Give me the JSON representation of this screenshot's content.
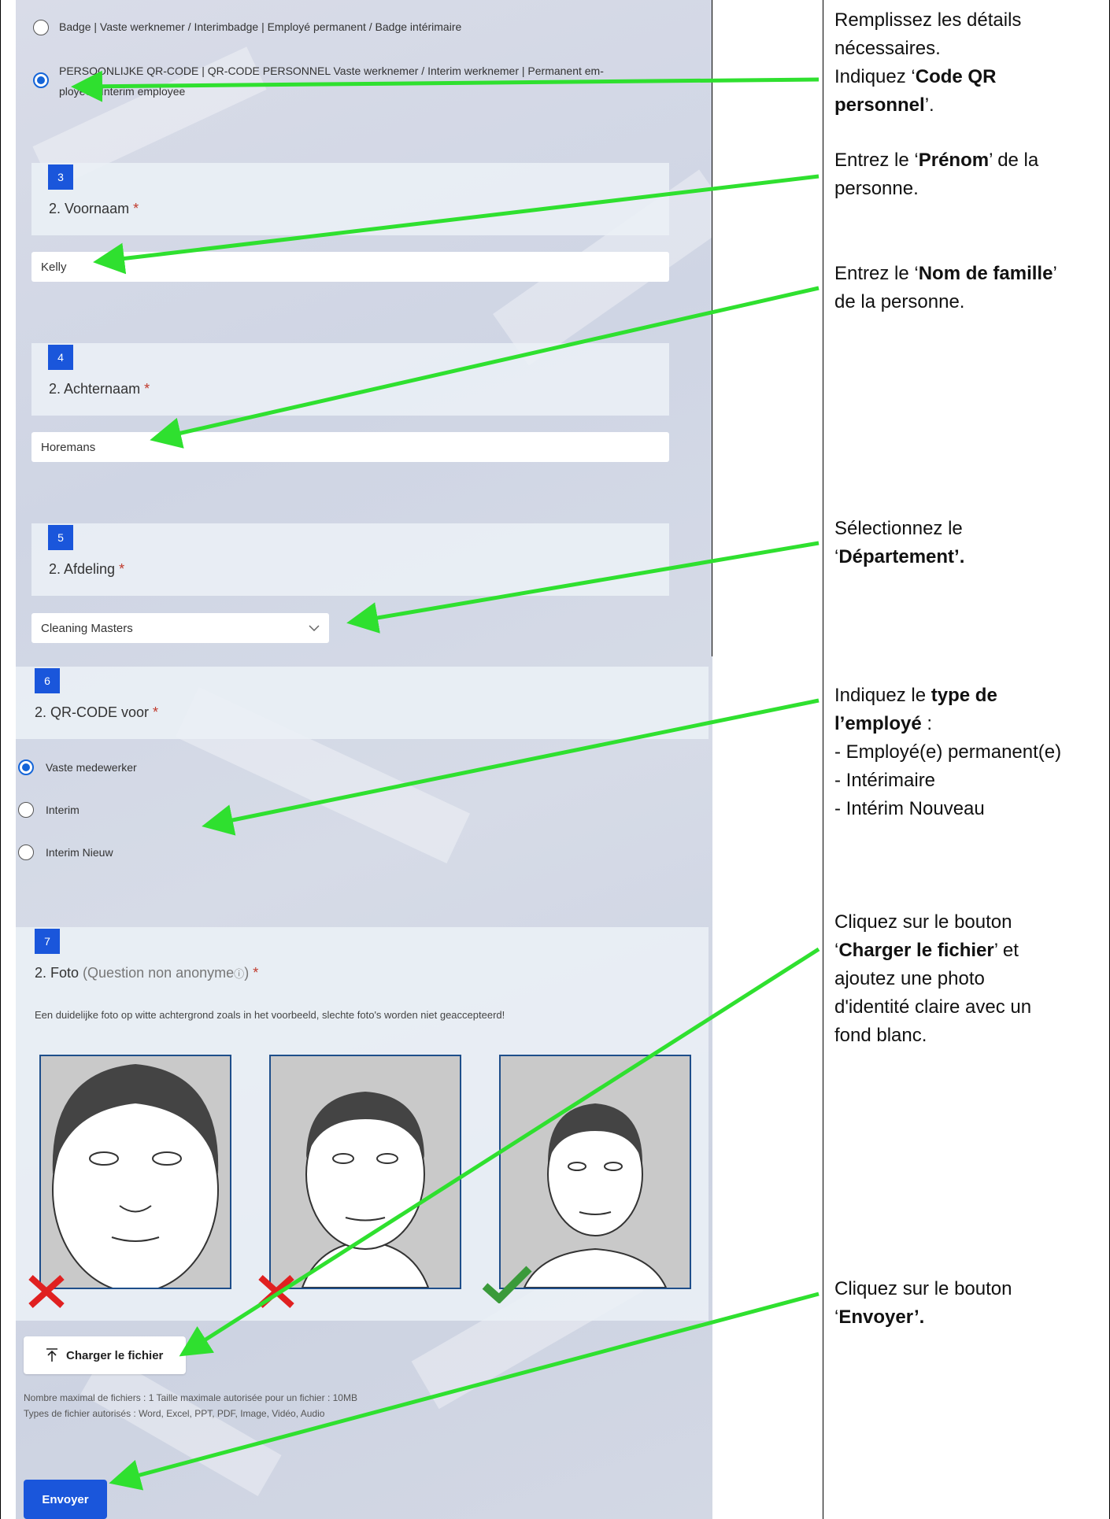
{
  "form": {
    "options_q1": [
      {
        "label": "Badge | Vaste werknemer / Interimbadge | Employé permanent / Badge intérimaire",
        "selected": false
      },
      {
        "label_line1": "PERSOONLIJKE QR-CODE | QR-CODE PERSONNEL  Vaste werknemer / Interim werknemer | Permanent em-",
        "label_line2": "ployee / Interim employee",
        "selected": true
      }
    ],
    "q3": {
      "number": "3",
      "title": "2. Voornaam",
      "required_mark": "*",
      "value": "Kelly"
    },
    "q4": {
      "number": "4",
      "title": "2. Achternaam",
      "required_mark": "*",
      "value": "Horemans"
    },
    "q5": {
      "number": "5",
      "title": "2. Afdeling",
      "required_mark": "*",
      "value": "Cleaning Masters"
    },
    "q6": {
      "number": "6",
      "title": "2. QR-CODE voor",
      "required_mark": "*",
      "options": [
        {
          "label": "Vaste medewerker",
          "selected": true
        },
        {
          "label": "Interim",
          "selected": false
        },
        {
          "label": "Interim Nieuw",
          "selected": false
        }
      ]
    },
    "q7": {
      "number": "7",
      "title": "2. Foto",
      "subtitle": "(Question non anonyme",
      "info_icon": "info-icon",
      "subtitle_close": ")",
      "required_mark": "*",
      "description": "Een duidelijke foto op witte achtergrond zoals in het voorbeeld, slechte foto's worden niet geaccepteerd!",
      "examples": [
        {
          "verdict": "cross",
          "color": "#e02020"
        },
        {
          "verdict": "cross",
          "color": "#e02020"
        },
        {
          "verdict": "check",
          "color": "#3a9a3a"
        }
      ]
    },
    "upload": {
      "icon": "upload-icon",
      "label": "Charger le fichier",
      "limits_line1": "Nombre maximal de fichiers : 1   Taille maximale autorisée pour un fichier : 10MB",
      "limits_line2": "Types de fichier autorisés : Word, Excel, PPT, PDF, Image, Vidéo, Audio"
    },
    "submit_label": "Envoyer",
    "accent": "#1a56db"
  },
  "instructions": {
    "i1": {
      "line1": "Remplissez les détails",
      "line2": "nécessaires.",
      "line3_pre": "Indiquez ‘",
      "line3_bold": "Code QR",
      "line4_bold": "personnel",
      "line4_post": "’."
    },
    "i2": {
      "pre": "Entrez le ‘",
      "bold": "Prénom",
      "post": "’ de la",
      "line2": "personne."
    },
    "i3": {
      "pre": "Entrez le ‘",
      "bold": "Nom de famille",
      "post": "’",
      "line2": "de la personne."
    },
    "i4": {
      "line1": "Sélectionnez le",
      "pre": "‘",
      "bold": "Département’."
    },
    "i5": {
      "pre": "Indiquez le ",
      "bold1": "type de",
      "bold2": "l’employé",
      "post": " :",
      "items": [
        "- Employé(e) permanent(e)",
        "- Intérimaire",
        "- Intérim Nouveau"
      ]
    },
    "i6": {
      "line1": "Cliquez sur le bouton",
      "pre": "‘",
      "bold": "Charger le fichier",
      "post": "’ et",
      "line3": "ajoutez une photo",
      "line4": "d'identité claire avec un",
      "line5": "fond blanc."
    },
    "i7": {
      "line1": "Cliquez sur le bouton",
      "pre": "‘",
      "bold": "Envoyer’."
    }
  },
  "arrow_color": "#2fe02f"
}
